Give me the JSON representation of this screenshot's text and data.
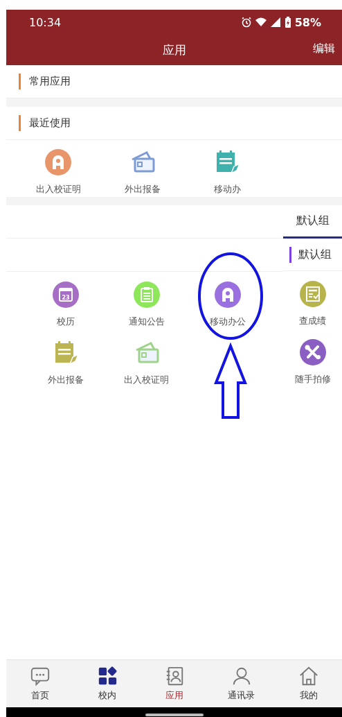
{
  "status_bar": {
    "time": "10:34",
    "battery": "58%"
  },
  "header": {
    "title": "应用",
    "action": "编辑"
  },
  "sections": [
    {
      "title": "常用应用"
    },
    {
      "title": "最近使用"
    }
  ],
  "recent_apps": [
    {
      "label": "出入校证明",
      "kind": "badge",
      "color": "#e8956a"
    },
    {
      "label": "外出报备",
      "kind": "card",
      "color": "#7f9bd4"
    },
    {
      "label": "移动办",
      "kind": "notepad",
      "color": "#40b2ad"
    }
  ],
  "group_tab": {
    "label": "默认组",
    "selected": true
  },
  "group_title": "默认组",
  "apps": [
    {
      "label": "校历",
      "kind": "calendar",
      "color": "#a66ec4",
      "icon_text": "23"
    },
    {
      "label": "通知公告",
      "kind": "clipboard",
      "color": "#8ee65a"
    },
    {
      "label": "移动办公",
      "kind": "badge",
      "color": "#9a6fe0"
    },
    {
      "label": "外出报备",
      "kind": "notepad",
      "color": "#bdb553"
    },
    {
      "label": "出入校证明",
      "kind": "card",
      "color": "#9fd28a"
    }
  ],
  "side_apps": [
    {
      "label": "查成绩",
      "kind": "score",
      "color": "#b8b44c"
    },
    {
      "label": "随手拍修",
      "kind": "tools",
      "color": "#8a5ec2"
    }
  ],
  "bottom_nav": [
    {
      "label": "首页",
      "kind": "chat",
      "selected": false
    },
    {
      "label": "校内",
      "kind": "grid",
      "selected": false
    },
    {
      "label": "应用",
      "kind": "contact",
      "selected": true
    },
    {
      "label": "通讯录",
      "kind": "person",
      "selected": false
    },
    {
      "label": "我的",
      "kind": "house",
      "selected": false
    }
  ]
}
